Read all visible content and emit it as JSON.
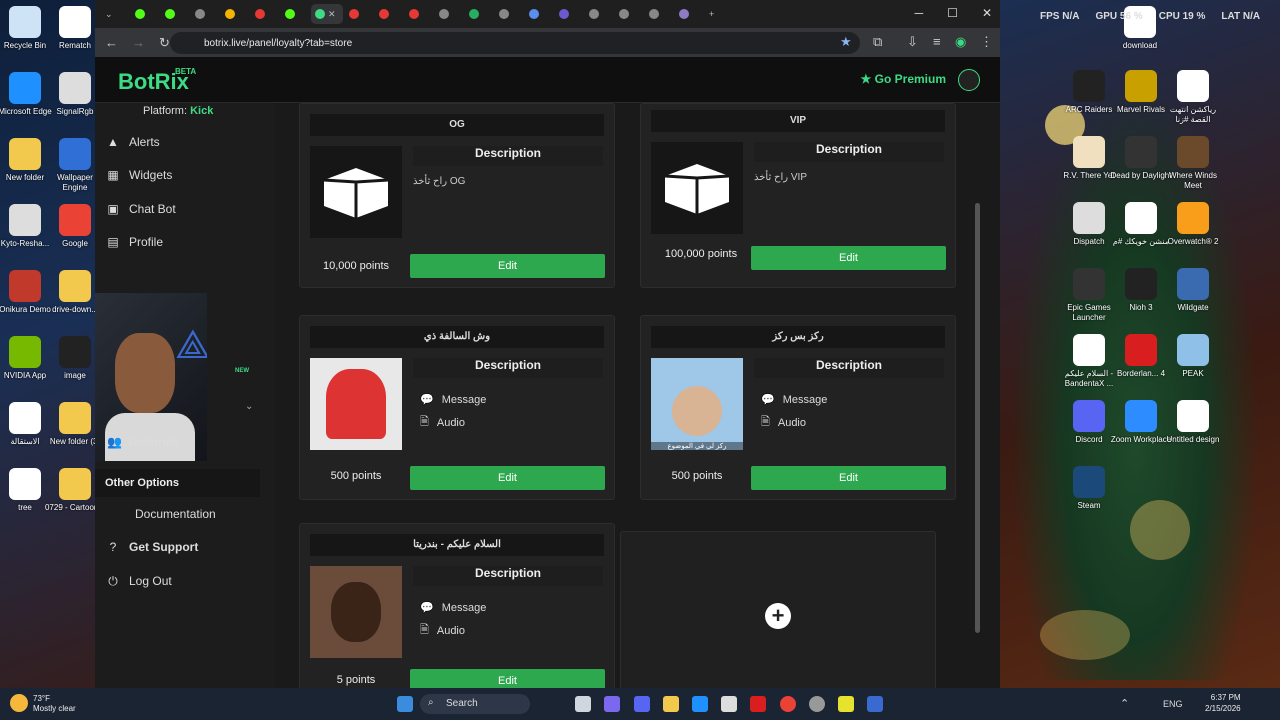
{
  "browser": {
    "url": "botrix.live/panel/loyalty?tab=store"
  },
  "desktop_left": [
    {
      "label": "Recycle Bin",
      "color": "#cfe3f7"
    },
    {
      "label": "Rematch",
      "color": "#ffffff"
    },
    {
      "label": "Microsoft Edge",
      "color": "#1e90ff"
    },
    {
      "label": "SignalRgb",
      "color": "#dddddd"
    },
    {
      "label": "New folder",
      "color": "#f2c94c"
    },
    {
      "label": "Wallpaper Engine",
      "color": "#2f6fd6"
    },
    {
      "label": "Kyto-Resha...",
      "color": "#dddddd"
    },
    {
      "label": "Google",
      "color": "#ea4335"
    },
    {
      "label": "Onikura Demo",
      "color": "#c0392b"
    },
    {
      "label": "drive-down...",
      "color": "#f2c94c"
    },
    {
      "label": "NVIDIA App",
      "color": "#76b900"
    },
    {
      "label": "image",
      "color": "#222222"
    },
    {
      "label": "الاستقالة",
      "color": "#ffffff"
    },
    {
      "label": "New folder (3)",
      "color": "#f2c94c"
    },
    {
      "label": "tree",
      "color": "#ffffff"
    },
    {
      "label": "0729 - Cartoon...",
      "color": "#f2c94c"
    }
  ],
  "desktop_right": [
    {
      "label": "download",
      "color": "#ffffff"
    },
    {
      "label": "ARC Raiders",
      "color": "#222222"
    },
    {
      "label": "Marvel Rivals",
      "color": "#c8a000"
    },
    {
      "label": "رياكشن انتهت القصة #زنا",
      "color": "#ffffff"
    },
    {
      "label": "R.V. There Yet",
      "color": "#f0e0c0"
    },
    {
      "label": "Dead by Daylight",
      "color": "#333333"
    },
    {
      "label": "Where Winds Meet",
      "color": "#6a4a2a"
    },
    {
      "label": "Dispatch",
      "color": "#dddddd"
    },
    {
      "label": "منشن خويكك #م",
      "color": "#ffffff"
    },
    {
      "label": "Overwatch® 2",
      "color": "#f99e1a"
    },
    {
      "label": "Epic Games Launcher",
      "color": "#333333"
    },
    {
      "label": "Nioh 3",
      "color": "#222222"
    },
    {
      "label": "Wildgate",
      "color": "#3a6ab0"
    },
    {
      "label": "السلام عليكم - BandentaX ...",
      "color": "#ffffff"
    },
    {
      "label": "Borderlan... 4",
      "color": "#d81e1e"
    },
    {
      "label": "PEAK",
      "color": "#8fc1e8"
    },
    {
      "label": "Discord",
      "color": "#5865f2"
    },
    {
      "label": "Zoom Workplace",
      "color": "#2d8cff"
    },
    {
      "label": "Untitled design",
      "color": "#ffffff"
    },
    {
      "label": "Steam",
      "color": "#1b4a7a"
    }
  ],
  "hud": {
    "fps_label": "FPS",
    "fps": "N/A",
    "gpu_label": "GPU",
    "gpu": "56 %",
    "cpu_label": "CPU",
    "cpu": "19 %",
    "lat_label": "LAT",
    "lat": "N/A"
  },
  "app": {
    "logo": "BotRix",
    "beta": "BETA",
    "premium": "Go Premium",
    "platform_label": "Platform:",
    "platform": "Kick",
    "new_badge": "NEW"
  },
  "sidebar": {
    "alerts": "Alerts",
    "widgets": "Widgets",
    "chatbot": "Chat Bot",
    "profile": "Profile",
    "referrals": "Referrals",
    "other": "Other Options",
    "docs": "Documentation",
    "support": "Get Support",
    "logout": "Log Out"
  },
  "cards": [
    {
      "title": "OG",
      "desc_title": "Description",
      "desc": "راح ثأخذ OG",
      "points": "10,000 points",
      "edit": "Edit"
    },
    {
      "title": "VIP",
      "desc_title": "Description",
      "desc": "راح ثأخذ VIP",
      "points": "100,000 points",
      "edit": "Edit"
    },
    {
      "title": "وش السالفة ذي",
      "desc_title": "Description",
      "opt1": "Message",
      "opt2": "Audio",
      "points": "500 points",
      "edit": "Edit"
    },
    {
      "title": "ركز بس ركز",
      "desc_title": "Description",
      "opt1": "Message",
      "opt2": "Audio",
      "points": "500 points",
      "edit": "Edit",
      "img_caption": "ركز لي في الموضوع"
    },
    {
      "title": "السلام عليكم - بندريتا",
      "desc_title": "Description",
      "opt1": "Message",
      "opt2": "Audio",
      "points": "5 points",
      "edit": "Edit"
    }
  ],
  "taskbar": {
    "weather_temp": "73°F",
    "weather_desc": "Mostly clear",
    "search": "Search",
    "lang": "ENG",
    "time": "6:37 PM",
    "date": "2/15/2026"
  }
}
